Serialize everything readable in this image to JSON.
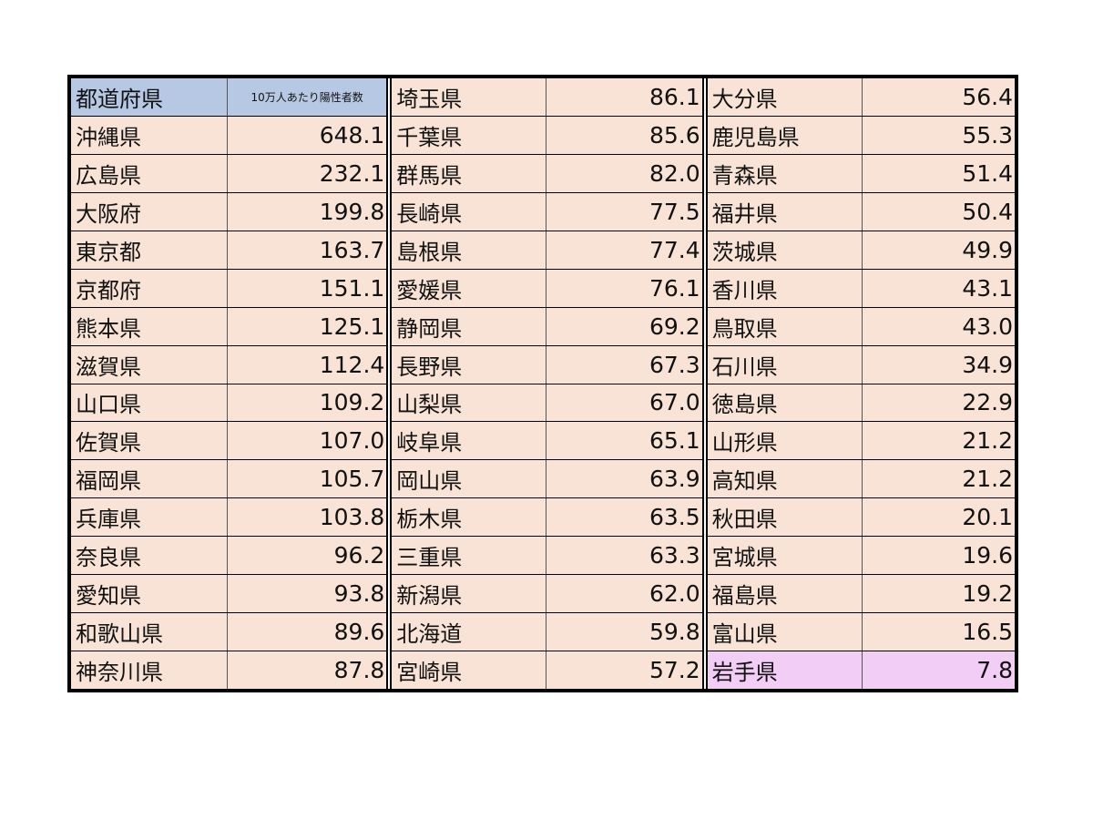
{
  "table": {
    "header": {
      "name": "都道府県",
      "value": "10万人あたり陽性者数"
    },
    "rows": [
      {
        "name": "沖縄県",
        "value": "648.1"
      },
      {
        "name": "広島県",
        "value": "232.1"
      },
      {
        "name": "大阪府",
        "value": "199.8"
      },
      {
        "name": "東京都",
        "value": "163.7"
      },
      {
        "name": "京都府",
        "value": "151.1"
      },
      {
        "name": "熊本県",
        "value": "125.1"
      },
      {
        "name": "滋賀県",
        "value": "112.4"
      },
      {
        "name": "山口県",
        "value": "109.2"
      },
      {
        "name": "佐賀県",
        "value": "107.0"
      },
      {
        "name": "福岡県",
        "value": "105.7"
      },
      {
        "name": "兵庫県",
        "value": "103.8"
      },
      {
        "name": "奈良県",
        "value": "96.2"
      },
      {
        "name": "愛知県",
        "value": "93.8"
      },
      {
        "name": "和歌山県",
        "value": "89.6"
      },
      {
        "name": "神奈川県",
        "value": "87.8"
      },
      {
        "name": "埼玉県",
        "value": "86.1"
      },
      {
        "name": "千葉県",
        "value": "85.6"
      },
      {
        "name": "群馬県",
        "value": "82.0"
      },
      {
        "name": "長崎県",
        "value": "77.5"
      },
      {
        "name": "島根県",
        "value": "77.4"
      },
      {
        "name": "愛媛県",
        "value": "76.1"
      },
      {
        "name": "静岡県",
        "value": "69.2"
      },
      {
        "name": "長野県",
        "value": "67.3"
      },
      {
        "name": "山梨県",
        "value": "67.0"
      },
      {
        "name": "岐阜県",
        "value": "65.1"
      },
      {
        "name": "岡山県",
        "value": "63.9"
      },
      {
        "name": "栃木県",
        "value": "63.5"
      },
      {
        "name": "三重県",
        "value": "63.3"
      },
      {
        "name": "新潟県",
        "value": "62.0"
      },
      {
        "name": "北海道",
        "value": "59.8"
      },
      {
        "name": "宮崎県",
        "value": "57.2"
      },
      {
        "name": "大分県",
        "value": "56.4"
      },
      {
        "name": "鹿児島県",
        "value": "55.3"
      },
      {
        "name": "青森県",
        "value": "51.4"
      },
      {
        "name": "福井県",
        "value": "50.4"
      },
      {
        "name": "茨城県",
        "value": "49.9"
      },
      {
        "name": "香川県",
        "value": "43.1"
      },
      {
        "name": "鳥取県",
        "value": "43.0"
      },
      {
        "name": "石川県",
        "value": "34.9"
      },
      {
        "name": "徳島県",
        "value": "22.9"
      },
      {
        "name": "山形県",
        "value": "21.2"
      },
      {
        "name": "高知県",
        "value": "21.2"
      },
      {
        "name": "秋田県",
        "value": "20.1"
      },
      {
        "name": "宮城県",
        "value": "19.6"
      },
      {
        "name": "福島県",
        "value": "19.2"
      },
      {
        "name": "富山県",
        "value": "16.5"
      },
      {
        "name": "岩手県",
        "value": "7.8",
        "highlight": true
      }
    ]
  },
  "colors": {
    "cell_bg": "#f8e3d6",
    "header_bg": "#b6c8e4",
    "highlight_bg": "#f2cdf5",
    "border": "#000000"
  }
}
